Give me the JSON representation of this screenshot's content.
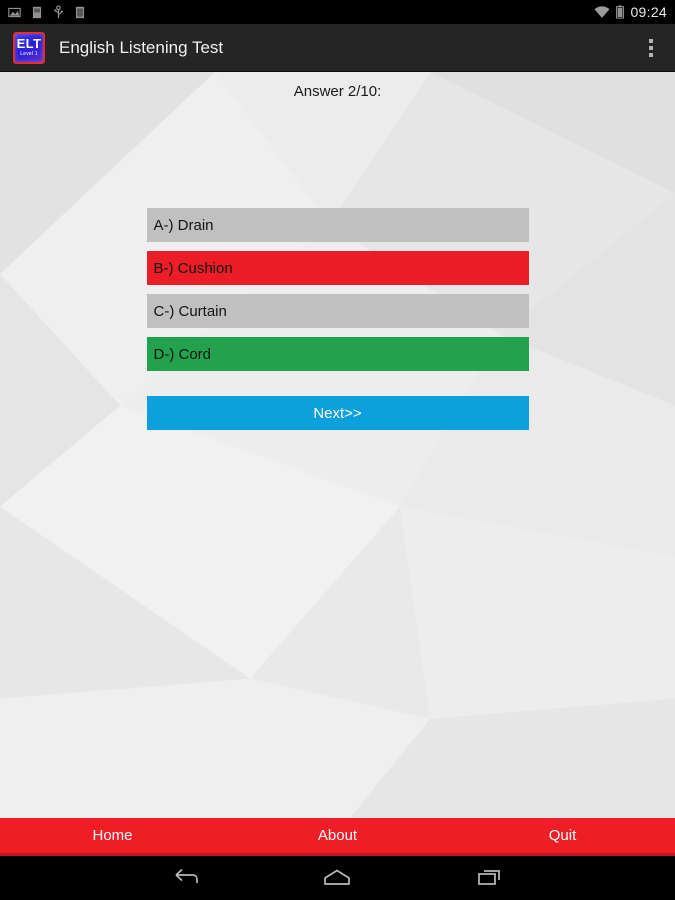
{
  "status_bar": {
    "icons": [
      "screenshot-icon",
      "sdcard-icon",
      "usb-icon",
      "storage-icon",
      "wifi-icon",
      "battery-icon"
    ],
    "time": "09:24"
  },
  "action_bar": {
    "logo_main": "ELT",
    "logo_sub": "Level 1",
    "title": "English Listening Test",
    "overflow_label": "More options"
  },
  "main": {
    "answer_label": "Answer 2/10:",
    "options": [
      {
        "label": "A-) Drain",
        "state": "neutral"
      },
      {
        "label": "B-) Cushion",
        "state": "wrong"
      },
      {
        "label": "C-) Curtain",
        "state": "neutral"
      },
      {
        "label": "D-) Cord",
        "state": "correct"
      }
    ],
    "next_label": "Next>>"
  },
  "bottom_nav": {
    "items": [
      {
        "label": "Home"
      },
      {
        "label": "About"
      },
      {
        "label": "Quit"
      }
    ]
  },
  "system_nav": {
    "back": "back-icon",
    "home": "home-icon",
    "recents": "recents-icon"
  },
  "colors": {
    "action_bar": "#252525",
    "option_neutral": "#c0c0c0",
    "option_wrong": "#ec1d26",
    "option_correct": "#22a24c",
    "next_button": "#0ca0dc",
    "bottom_nav": "#ee1d26",
    "background": "#e9e9e9"
  }
}
